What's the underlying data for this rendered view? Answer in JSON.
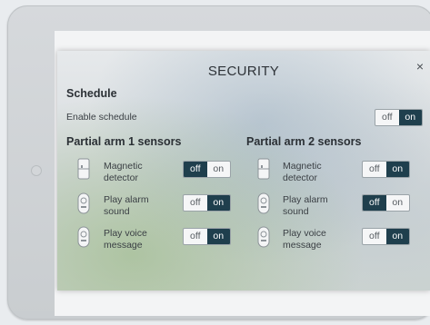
{
  "dialog": {
    "title": "SECURITY",
    "close_glyph": "×"
  },
  "schedule": {
    "heading": "Schedule",
    "enable_label": "Enable schedule",
    "toggle": {
      "off": "off",
      "on": "on",
      "selected": "on"
    }
  },
  "group1": {
    "heading": "Partial arm 1 sensors",
    "items": [
      {
        "label_line1": "Magnetic",
        "label_line2": "detector",
        "icon": "magnetic-detector-icon",
        "off": "off",
        "on": "on",
        "selected": "off"
      },
      {
        "label_line1": "Play alarm",
        "label_line2": "sound",
        "icon": "alarm-siren-icon",
        "off": "off",
        "on": "on",
        "selected": "on"
      },
      {
        "label_line1": "Play voice",
        "label_line2": "message",
        "icon": "voice-message-icon",
        "off": "off",
        "on": "on",
        "selected": "on"
      }
    ]
  },
  "group2": {
    "heading": "Partial arm 2 sensors",
    "items": [
      {
        "label_line1": "Magnetic",
        "label_line2": "detector",
        "icon": "magnetic-detector-icon",
        "off": "off",
        "on": "on",
        "selected": "on"
      },
      {
        "label_line1": "Play alarm",
        "label_line2": "sound",
        "icon": "alarm-siren-icon",
        "off": "off",
        "on": "on",
        "selected": "off"
      },
      {
        "label_line1": "Play voice",
        "label_line2": "message",
        "icon": "voice-message-icon",
        "off": "off",
        "on": "on",
        "selected": "on"
      }
    ]
  },
  "colors": {
    "toggle_selected": "#1f3f4d",
    "toggle_bg": "#f5f6f7"
  }
}
